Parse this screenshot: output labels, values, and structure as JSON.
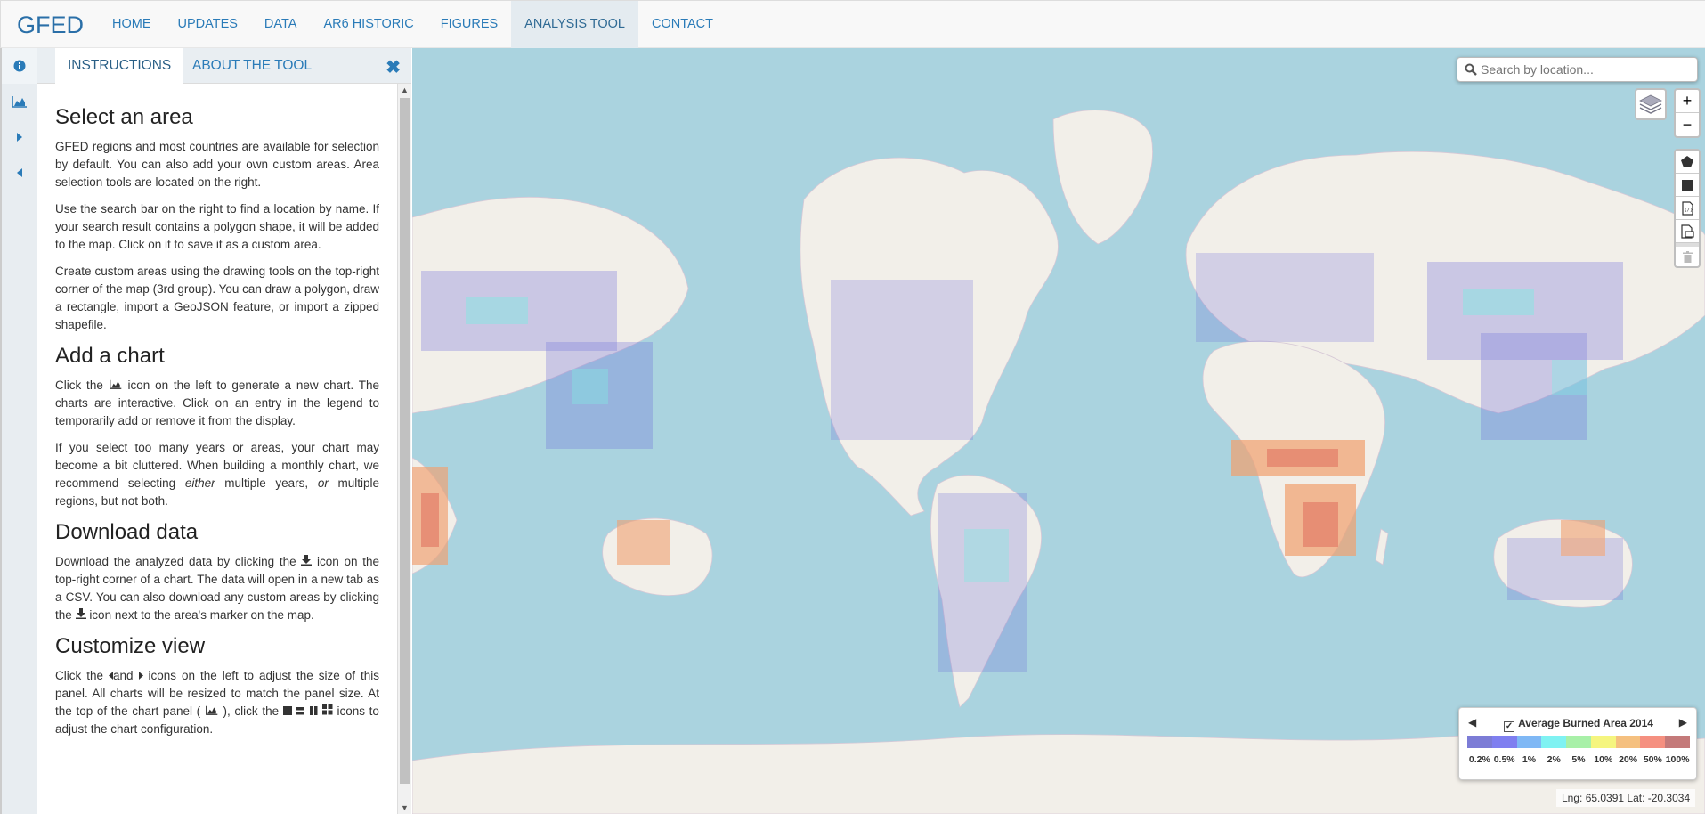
{
  "navbar": {
    "brand": "GFED",
    "items": [
      {
        "label": "HOME"
      },
      {
        "label": "UPDATES"
      },
      {
        "label": "DATA"
      },
      {
        "label": "AR6 HISTORIC"
      },
      {
        "label": "FIGURES"
      },
      {
        "label": "ANALYSIS TOOL",
        "active": true
      },
      {
        "label": "CONTACT"
      }
    ]
  },
  "sidebar": {
    "tabs": [
      "info-icon",
      "chart-icon",
      "expand-right-icon",
      "collapse-left-icon"
    ],
    "panel_tabs": [
      {
        "label": "INSTRUCTIONS",
        "active": true
      },
      {
        "label": "ABOUT THE TOOL"
      }
    ],
    "close_glyph": "✖",
    "sections": {
      "select": {
        "title": "Select an area",
        "p1": "GFED regions and most countries are available for selection by default. You can also add your own custom areas. Area selection tools are located on the right.",
        "p2": "Use the search bar on the right to find a location by name. If your search result contains a polygon shape, it will be added to the map. Click on it to save it as a custom area.",
        "p3": "Create custom areas using the drawing tools on the top-right corner of the map (3rd group). You can draw a polygon, draw a rectangle, import a GeoJSON feature, or import a zipped shapefile."
      },
      "chart": {
        "title": "Add a chart",
        "p1a": "Click the",
        "p1b": "icon on the left to generate a new chart. The charts are interactive. Click on an entry in the legend to temporarily add or remove it from the display.",
        "p2a": "If you select too many years or areas, your chart may become a bit cluttered. When building a monthly chart, we recommend selecting",
        "p2_em1": "either",
        "p2b": "multiple years,",
        "p2_em2": "or",
        "p2c": "multiple regions, but not both."
      },
      "download": {
        "title": "Download data",
        "p1a": "Download the analyzed data by clicking the",
        "p1b": "icon on the top-right corner of a chart. The data will open in a new tab as a CSV. You can also download any custom areas by clicking the",
        "p1c": "icon next to the area's marker on the map."
      },
      "customize": {
        "title": "Customize view",
        "p1a": "Click the",
        "p1b": "and",
        "p1c": "icons on the left to adjust the size of this panel. All charts will be resized to match the panel size. At the top of the chart panel (",
        "p1d": "), click the",
        "p1e": "icons to adjust the chart configuration."
      }
    }
  },
  "map": {
    "search_placeholder": "Search by location...",
    "zoom_in": "+",
    "zoom_out": "−",
    "draw_tools": [
      "polygon-icon",
      "rectangle-icon",
      "geojson-import-icon",
      "shapefile-import-icon",
      "trash-icon"
    ],
    "legend": {
      "title": "Average Burned Area 2014",
      "checked": true,
      "colors": [
        "#7c7cd6",
        "#7f7ff0",
        "#7fb8f5",
        "#7ff2f2",
        "#a8f0a8",
        "#f5f57f",
        "#f5c07f",
        "#f59080",
        "#c47a7a"
      ],
      "labels": [
        "0.2%",
        "0.5%",
        "1%",
        "2%",
        "5%",
        "10%",
        "20%",
        "50%",
        "100%"
      ]
    },
    "coords": "Lng: 65.0391 Lat: -20.3034",
    "colors": {
      "ocean": "#aad3df",
      "land": "#f2efe9",
      "ice": "#f2efe9"
    }
  }
}
